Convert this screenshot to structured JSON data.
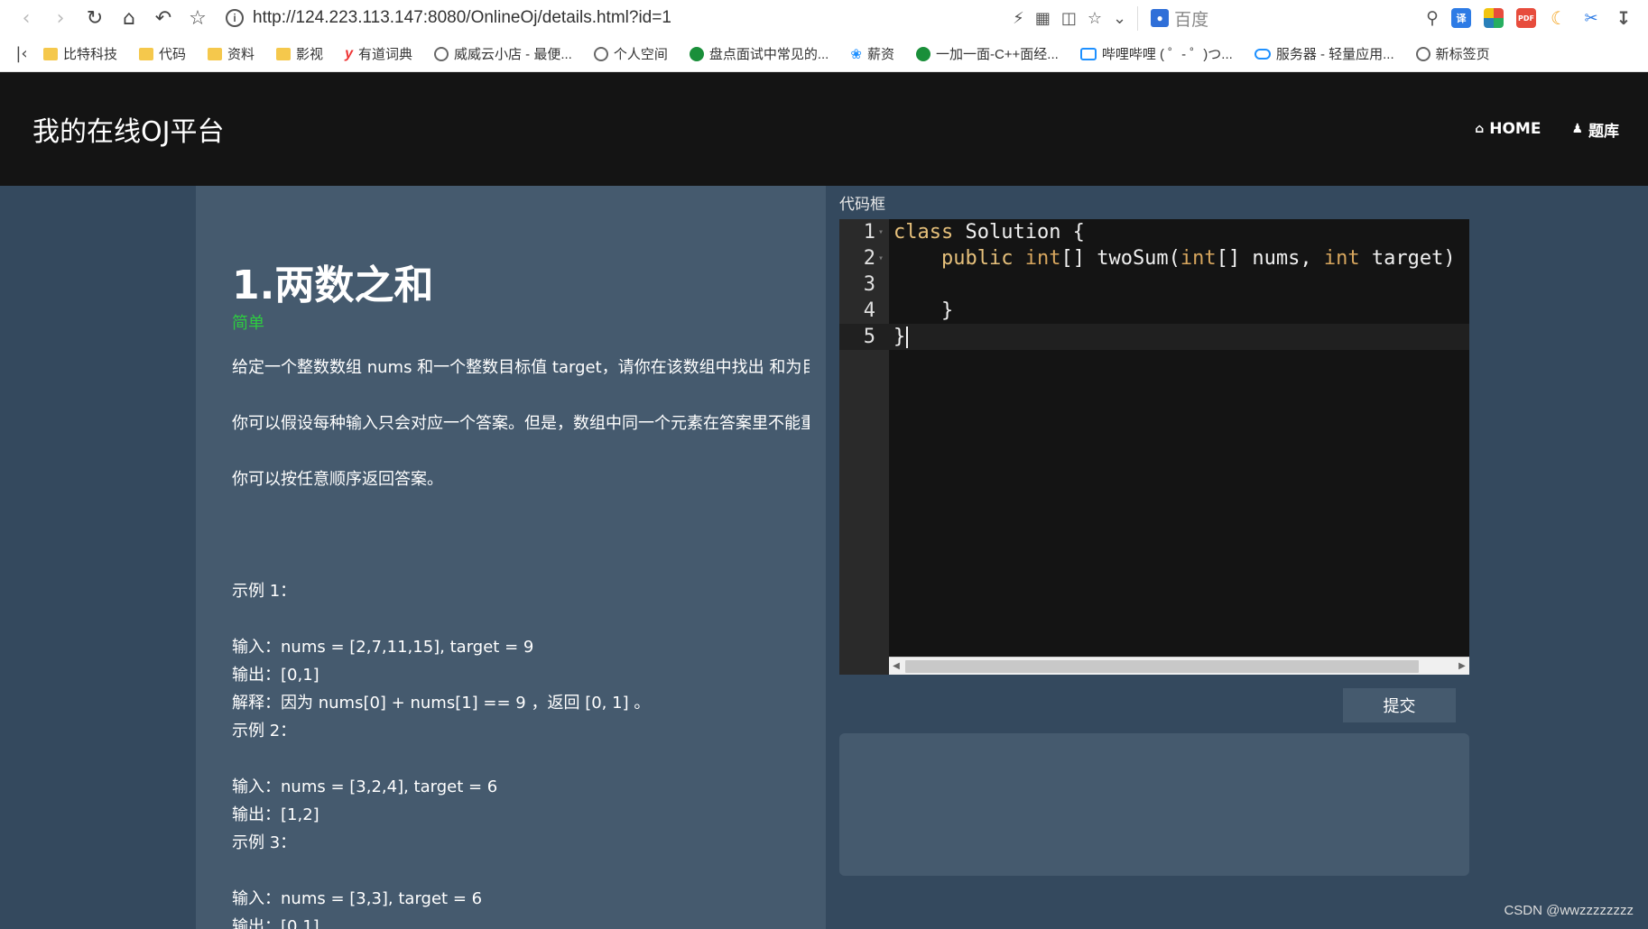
{
  "browser": {
    "url": "http://124.223.113.147:8080/OnlineOj/details.html?id=1",
    "search_engine": "百度",
    "bookmarks": [
      {
        "label": "比特科技",
        "icon": "folder-icon"
      },
      {
        "label": "代码",
        "icon": "folder-icon"
      },
      {
        "label": "资料",
        "icon": "folder-icon"
      },
      {
        "label": "影视",
        "icon": "folder-icon"
      },
      {
        "label": "有道词典",
        "icon": "youdao-icon"
      },
      {
        "label": "威威云小店 - 最便...",
        "icon": "globe-icon"
      },
      {
        "label": "个人空间",
        "icon": "globe-icon"
      },
      {
        "label": "盘点面试中常见的...",
        "icon": "shield-icon"
      },
      {
        "label": "薪资",
        "icon": "leaf-icon"
      },
      {
        "label": "一加一面-C++面经...",
        "icon": "shield-icon"
      },
      {
        "label": "哔哩哔哩 ( ゜- ゜)つ...",
        "icon": "bilibili-icon"
      },
      {
        "label": "服务器 - 轻量应用...",
        "icon": "cloud-icon"
      },
      {
        "label": "新标签页",
        "icon": "globe-icon"
      }
    ]
  },
  "site": {
    "brand": "我的在线OJ平台",
    "nav": [
      {
        "label": "HOME",
        "icon": "home-icon"
      },
      {
        "label": "题库",
        "icon": "user-icon"
      }
    ]
  },
  "problem": {
    "title": "1.两数之和",
    "level": "简单",
    "level_color": "#2ecc40",
    "desc_lines": [
      "给定一个整数数组 nums 和一个整数目标值 target，请你在该数组中找出 和为目标值",
      "你可以假设每种输入只会对应一个答案。但是，数组中同一个元素在答案里不能重复出现。",
      "你可以按任意顺序返回答案。"
    ],
    "examples": [
      {
        "heading": "示例 1：",
        "lines": [
          "输入：nums = [2,7,11,15], target = 9",
          "输出：[0,1]",
          "解释：因为 nums[0] + nums[1] == 9 ，返回 [0, 1] 。"
        ]
      },
      {
        "heading": "示例 2：",
        "lines": [
          "输入：nums = [3,2,4], target = 6",
          "输出：[1,2]"
        ]
      },
      {
        "heading": "示例 3：",
        "lines": [
          "输入：nums = [3,3], target = 6",
          "输出：[0,1]"
        ]
      }
    ]
  },
  "editor": {
    "title": "代码框",
    "line_numbers": [
      "1",
      "2",
      "3",
      "4",
      "5"
    ],
    "lines": [
      {
        "kw": "class",
        "rest": " Solution {"
      },
      {
        "indent": "    ",
        "kw": "public",
        "sp": " ",
        "ty": "int",
        "rest": "[] twoSum(",
        "ty2": "int",
        "rest2": "[] nums, ",
        "ty3": "int",
        "rest3": " target) {"
      },
      {
        "rest": ""
      },
      {
        "rest": "    }"
      },
      {
        "rest": "}"
      }
    ]
  },
  "submit_label": "提交",
  "watermark": "CSDN @wwzzzzzzzz"
}
